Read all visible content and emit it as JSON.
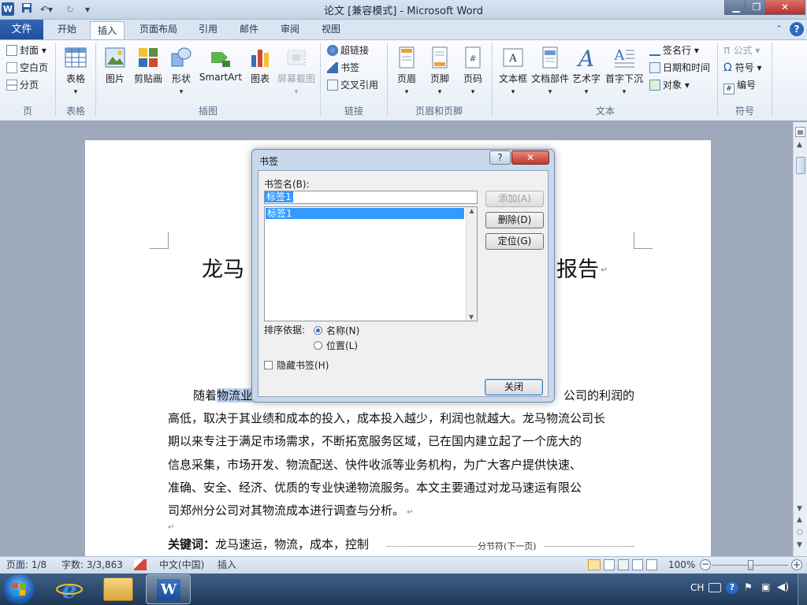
{
  "window": {
    "title": "论文 [兼容模式] - Microsoft Word",
    "app_icon": "W",
    "controls": [
      "minimize-icon",
      "restore-icon",
      "close-icon"
    ]
  },
  "ribbon_tabs": [
    "文件",
    "开始",
    "插入",
    "页面布局",
    "引用",
    "邮件",
    "审阅",
    "视图"
  ],
  "active_tab": "插入",
  "ribbon": {
    "pages": {
      "label": "页",
      "items": [
        "封面",
        "空白页",
        "分页"
      ]
    },
    "tables": {
      "label": "表格",
      "items": [
        "表格"
      ]
    },
    "illustrations": {
      "label": "插图",
      "items": [
        "图片",
        "剪贴画",
        "形状",
        "SmartArt",
        "图表",
        "屏幕截图"
      ]
    },
    "links": {
      "label": "链接",
      "items": [
        "超链接",
        "书签",
        "交叉引用"
      ]
    },
    "header_footer": {
      "label": "页眉和页脚",
      "items": [
        "页眉",
        "页脚",
        "页码"
      ]
    },
    "text": {
      "label": "文本",
      "items": [
        "文本框",
        "文档部件",
        "艺术字",
        "首字下沉"
      ],
      "small": [
        "签名行",
        "日期和时间",
        "对象"
      ]
    },
    "symbols": {
      "label": "符号",
      "items": [
        "公式",
        "符号",
        "编号"
      ]
    }
  },
  "document": {
    "title_left": "龙马",
    "title_right": "报告",
    "first_line_start": "随着",
    "first_line_highlight": "物流业",
    "first_line_end": "公司的利润的",
    "lines": [
      "高低，取决于其业绩和成本的投入，成本投入越少，利润也就越大。龙马物流公司长",
      "期以来专注于满足市场需求，不断拓宽服务区域，已在国内建立起了一个庞大的",
      "信息采集，市场开发、物流配送、快件收派等业务机构，为广大客户提供快速、",
      "准确、安全、经济、优质的专业快递物流服务。本文主要通过对龙马速运有限公",
      "司郑州分公司对其物流成本进行调查与分析。"
    ],
    "keywords_label": "关键词：",
    "keywords": "龙马速运，物流，成本，控制",
    "section_break": "分节符(下一页)"
  },
  "dialog": {
    "title": "书签",
    "name_label": "书签名(B):",
    "name_value": "标签1",
    "list_items": [
      "标签1"
    ],
    "buttons": {
      "add": "添加(A)",
      "delete": "删除(D)",
      "goto": "定位(G)",
      "close": "关闭"
    },
    "sort_label": "排序依据:",
    "sort_options": [
      "名称(N)",
      "位置(L)"
    ],
    "sort_selected": "名称(N)",
    "hide_label": "隐藏书签(H)",
    "help": "?"
  },
  "status": {
    "page": "页面: 1/8",
    "words": "字数: 3/3,863",
    "language": "中文(中国)",
    "mode": "插入",
    "zoom": "100%",
    "zoom_level": 1.0
  },
  "taskbar": {
    "tray_lang": "CH",
    "apps": [
      "windows-start-icon",
      "internet-explorer-icon",
      "file-explorer-icon",
      "word-icon"
    ]
  },
  "colors": {
    "accent": "#2a5aa8",
    "selection": "#3399ff",
    "text_highlight": "#b9d4f4"
  }
}
